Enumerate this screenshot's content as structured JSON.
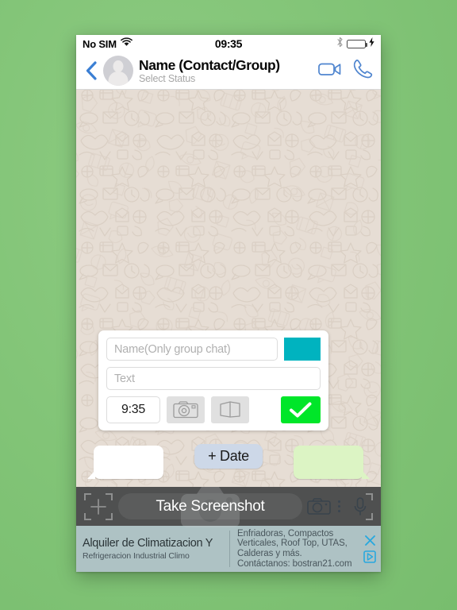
{
  "app": {
    "background_color": "#83c578",
    "frame_color": "#ffffff"
  },
  "status_bar": {
    "carrier": "No SIM",
    "wifi_icon": "wifi-icon",
    "time": "09:35",
    "bluetooth_icon": "bluetooth-icon",
    "battery_icon": "battery-icon",
    "battery_color": "#2fd82f",
    "charging_icon": "lightning-bolt-icon"
  },
  "nav": {
    "back_icon": "back-chevron-icon",
    "avatar_icon": "default-avatar-icon",
    "title": "Name (Contact/Group)",
    "subtitle": "Select Status",
    "video_call_icon": "video-camera-icon",
    "voice_call_icon": "phone-handset-icon",
    "accent_color": "#3b7fd4"
  },
  "chat": {
    "background_color": "#e6ddd4",
    "doodle_color": "#ded3c8"
  },
  "editor": {
    "name_field": {
      "value": "",
      "placeholder": "Name(Only group chat)"
    },
    "color_swatch": {
      "label": "",
      "color": "#00b3bf",
      "name": "color-picker-swatch"
    },
    "text_field": {
      "value": "",
      "placeholder": "Text"
    },
    "time_value": "9:35",
    "camera_button_icon": "camera-icon",
    "gallery_button_icon": "photos-gallery-icon",
    "confirm_button_icon": "checkmark-icon",
    "confirm_color": "#00e629"
  },
  "bubbles": {
    "incoming_color": "#ffffff",
    "outgoing_color": "#dcf4c4",
    "date_button_label": "+ Date",
    "date_button_color": "#cdd8e8"
  },
  "toolbar": {
    "background_color": "#4f5050",
    "add_icon": "crosshair-plus-icon",
    "screenshot_label": "Take Screenshot",
    "ghost_camera_icon": "camera-watermark-icon",
    "camera_icon": "camera-icon",
    "overflow_icon": "three-dots-menu-icon",
    "mic_icon": "microphone-icon"
  },
  "ad": {
    "background_color": "#aec2c4",
    "title": "Alquiler de Climatizacion Y",
    "subtitle": "Refrigeracion Industrial Climo",
    "body": "Enfriadoras, Compactos Verticales, Roof Top, UTAS, Calderas y más. Contáctanos: bostran21.com",
    "close_icon": "close-x-icon",
    "info_icon": "ad-choices-triangle-icon",
    "control_color": "#29a8de"
  }
}
